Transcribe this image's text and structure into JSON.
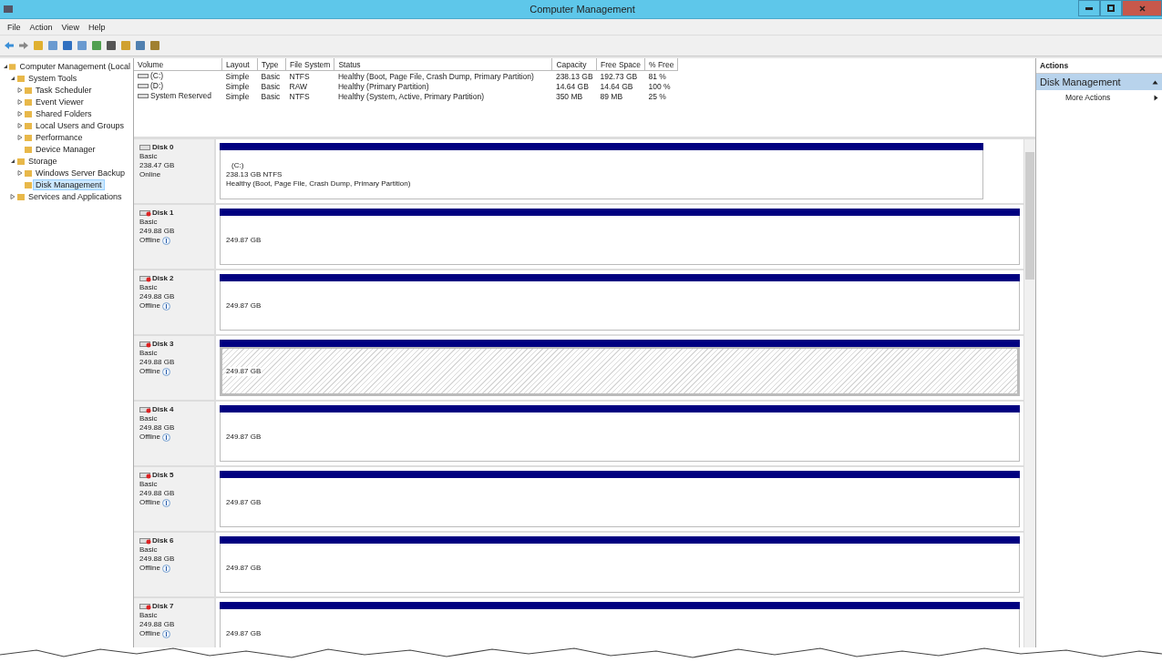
{
  "window": {
    "title": "Computer Management"
  },
  "menu": [
    "File",
    "Action",
    "View",
    "Help"
  ],
  "tree": [
    {
      "label": "Computer Management (Local",
      "expanded": true,
      "selected": false,
      "children": [
        {
          "label": "System Tools",
          "expanded": true,
          "selected": false,
          "children": [
            {
              "label": "Task Scheduler",
              "expanded": false,
              "selected": false
            },
            {
              "label": "Event Viewer",
              "expanded": false,
              "selected": false
            },
            {
              "label": "Shared Folders",
              "expanded": false,
              "selected": false
            },
            {
              "label": "Local Users and Groups",
              "expanded": false,
              "selected": false
            },
            {
              "label": "Performance",
              "expanded": false,
              "selected": false
            },
            {
              "label": "Device Manager",
              "selected": false
            }
          ]
        },
        {
          "label": "Storage",
          "expanded": true,
          "selected": false,
          "children": [
            {
              "label": "Windows Server Backup",
              "expanded": false,
              "selected": false
            },
            {
              "label": "Disk Management",
              "selected": true
            }
          ]
        },
        {
          "label": "Services and Applications",
          "expanded": false,
          "selected": false
        }
      ]
    }
  ],
  "volumes": {
    "columns": [
      "Volume",
      "Layout",
      "Type",
      "File System",
      "Status",
      "Capacity",
      "Free Space",
      "% Free"
    ],
    "rows": [
      [
        "(C:)",
        "Simple",
        "Basic",
        "NTFS",
        "Healthy (Boot, Page File, Crash Dump, Primary Partition)",
        "238.13 GB",
        "192.73 GB",
        "81 %"
      ],
      [
        "(D:)",
        "Simple",
        "Basic",
        "RAW",
        "Healthy (Primary Partition)",
        "14.64 GB",
        "14.64 GB",
        "100 %"
      ],
      [
        "System Reserved",
        "Simple",
        "Basic",
        "NTFS",
        "Healthy (System, Active, Primary Partition)",
        "350 MB",
        "89 MB",
        "25 %"
      ]
    ]
  },
  "disks": [
    {
      "name": "Disk 0",
      "type": "Basic",
      "size": "238.47 GB",
      "status": "Online",
      "online": true,
      "partition": {
        "label": "(C:)",
        "size": "238.13 GB NTFS",
        "status": "Healthy (Boot, Page File, Crash Dump, Primary Partition)",
        "selected": false
      }
    },
    {
      "name": "Disk 1",
      "type": "Basic",
      "size": "249.88 GB",
      "status": "Offline",
      "online": false,
      "partition": {
        "size": "249.87 GB",
        "selected": false
      }
    },
    {
      "name": "Disk 2",
      "type": "Basic",
      "size": "249.88 GB",
      "status": "Offline",
      "online": false,
      "partition": {
        "size": "249.87 GB",
        "selected": false
      }
    },
    {
      "name": "Disk 3",
      "type": "Basic",
      "size": "249.88 GB",
      "status": "Offline",
      "online": false,
      "partition": {
        "size": "249.87 GB",
        "selected": true
      }
    },
    {
      "name": "Disk 4",
      "type": "Basic",
      "size": "249.88 GB",
      "status": "Offline",
      "online": false,
      "partition": {
        "size": "249.87 GB",
        "selected": false
      }
    },
    {
      "name": "Disk 5",
      "type": "Basic",
      "size": "249.88 GB",
      "status": "Offline",
      "online": false,
      "partition": {
        "size": "249.87 GB",
        "selected": false
      }
    },
    {
      "name": "Disk 6",
      "type": "Basic",
      "size": "249.88 GB",
      "status": "Offline",
      "online": false,
      "partition": {
        "size": "249.87 GB",
        "selected": false
      }
    },
    {
      "name": "Disk 7",
      "type": "Basic",
      "size": "249.88 GB",
      "status": "Offline",
      "online": false,
      "partition": {
        "size": "249.87 GB",
        "selected": false
      }
    }
  ],
  "actions": {
    "title": "Actions",
    "group": "Disk Management",
    "items": [
      "More Actions"
    ]
  }
}
